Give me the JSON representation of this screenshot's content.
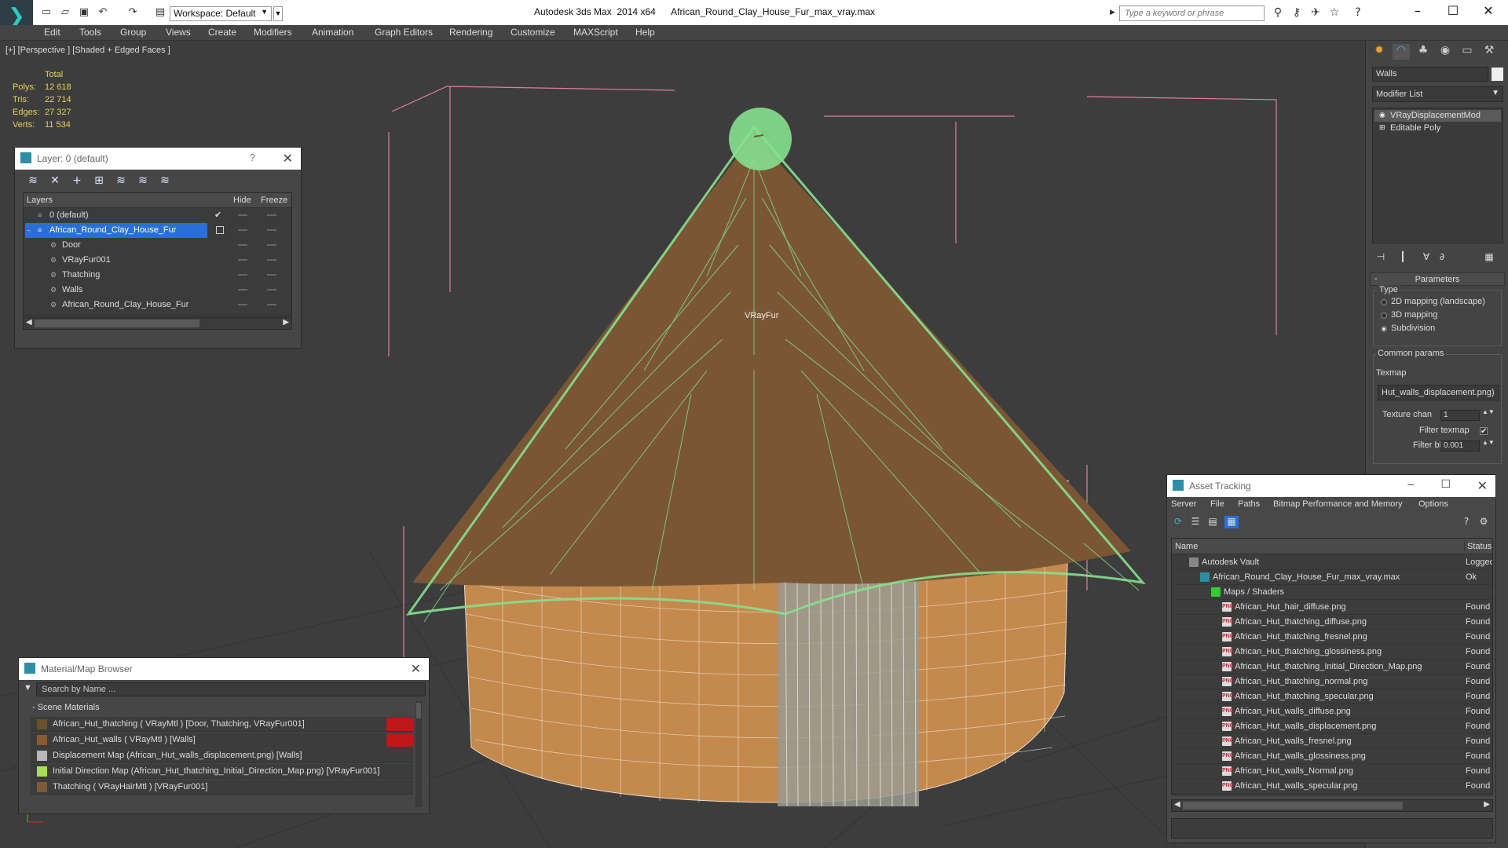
{
  "titlebar": {
    "workspace": "Workspace: Default",
    "app_title": "Autodesk 3ds Max  2014 x64      African_Round_Clay_House_Fur_max_vray.max",
    "search_placeholder": "Type a keyword or phrase"
  },
  "menu": [
    "Edit",
    "Tools",
    "Group",
    "Views",
    "Create",
    "Modifiers",
    "Animation",
    "Graph Editors",
    "Rendering",
    "Customize",
    "MAXScript",
    "Help"
  ],
  "viewport": {
    "label": "[+] [Perspective ] [Shaded + Edged Faces ]",
    "stats": {
      "total_label": "Total",
      "rows": [
        {
          "label": "Polys:",
          "value": "12 618"
        },
        {
          "label": "Tris:",
          "value": "22 714"
        },
        {
          "label": "Edges:",
          "value": "27 327"
        },
        {
          "label": "Verts:",
          "value": "11 534"
        }
      ]
    },
    "object_label": "VRayFur"
  },
  "layer_window": {
    "title": "Layer: 0 (default)",
    "help": "?",
    "columns": {
      "layers": "Layers",
      "hide": "Hide",
      "freeze": "Freeze"
    },
    "rows": [
      {
        "name": "0 (default)",
        "level": 0,
        "active": true
      },
      {
        "name": "African_Round_Clay_House_Fur",
        "level": 0,
        "selected": true
      },
      {
        "name": "Door",
        "level": 1
      },
      {
        "name": "VRayFur001",
        "level": 1
      },
      {
        "name": "Thatching",
        "level": 1
      },
      {
        "name": "Walls",
        "level": 1
      },
      {
        "name": "African_Round_Clay_House_Fur",
        "level": 1
      }
    ]
  },
  "material_browser": {
    "title": "Material/Map Browser",
    "search_placeholder": "Search by Name ...",
    "group": "- Scene Materials",
    "items": [
      {
        "text": "African_Hut_thatching  ( VRayMtl ) [Door, Thatching, VRayFur001]",
        "swatch": "#6a5230",
        "flag": true
      },
      {
        "text": "African_Hut_walls  ( VRayMtl ) [Walls]",
        "swatch": "#8a5a30",
        "flag": true
      },
      {
        "text": "Displacement Map (African_Hut_walls_displacement.png) [Walls]",
        "swatch": "#b8b8b8",
        "flag": false
      },
      {
        "text": "Initial Direction Map (African_Hut_thatching_Initial_Direction_Map.png) [VRayFur001]",
        "swatch": "#a8e04a",
        "flag": false
      },
      {
        "text": "Thatching  ( VRayHairMtl ) [VRayFur001]",
        "swatch": "#7a5a38",
        "flag": false
      }
    ]
  },
  "command_panel": {
    "object_name": "Walls",
    "modifier_list": "Modifier List",
    "stack": [
      "VRayDisplacementMod",
      "Editable Poly"
    ],
    "parameters_title": "Parameters",
    "type_label": "Type",
    "type_options": [
      "2D mapping (landscape)",
      "3D mapping",
      "Subdivision"
    ],
    "selected_type": 2,
    "common_params": "Common params",
    "texmap_label": "Texmap",
    "texmap_value": "Hut_walls_displacement.png)",
    "texture_chan_label": "Texture chan",
    "texture_chan_value": "1",
    "filter_texmap_label": "Filter texmap",
    "filter_blur_label": "Filter blur",
    "filter_blur_value": "0.001"
  },
  "asset_tracking": {
    "title": "Asset Tracking",
    "menu": [
      "Server",
      "File",
      "Paths",
      "Bitmap Performance and Memory",
      "Options"
    ],
    "columns": {
      "name": "Name",
      "status": "Status"
    },
    "rows": [
      {
        "name": "Autodesk Vault",
        "status": "Logged",
        "level": 0,
        "icon": "vault"
      },
      {
        "name": "African_Round_Clay_House_Fur_max_vray.max",
        "status": "Ok",
        "level": 1,
        "icon": "max"
      },
      {
        "name": "Maps / Shaders",
        "status": "",
        "level": 2,
        "icon": "maps"
      },
      {
        "name": "African_Hut_hair_diffuse.png",
        "status": "Found",
        "level": 3,
        "icon": "png"
      },
      {
        "name": "African_Hut_thatching_diffuse.png",
        "status": "Found",
        "level": 3,
        "icon": "png"
      },
      {
        "name": "African_Hut_thatching_fresnel.png",
        "status": "Found",
        "level": 3,
        "icon": "png"
      },
      {
        "name": "African_Hut_thatching_glossiness.png",
        "status": "Found",
        "level": 3,
        "icon": "png"
      },
      {
        "name": "African_Hut_thatching_Initial_Direction_Map.png",
        "status": "Found",
        "level": 3,
        "icon": "png"
      },
      {
        "name": "African_Hut_thatching_normal.png",
        "status": "Found",
        "level": 3,
        "icon": "png"
      },
      {
        "name": "African_Hut_thatching_specular.png",
        "status": "Found",
        "level": 3,
        "icon": "png"
      },
      {
        "name": "African_Hut_walls_diffuse.png",
        "status": "Found",
        "level": 3,
        "icon": "png"
      },
      {
        "name": "African_Hut_walls_displacement.png",
        "status": "Found",
        "level": 3,
        "icon": "png"
      },
      {
        "name": "African_Hut_walls_fresnel.png",
        "status": "Found",
        "level": 3,
        "icon": "png"
      },
      {
        "name": "African_Hut_walls_glossiness.png",
        "status": "Found",
        "level": 3,
        "icon": "png"
      },
      {
        "name": "African_Hut_walls_Normal.png",
        "status": "Found",
        "level": 3,
        "icon": "png"
      },
      {
        "name": "African_Hut_walls_specular.png",
        "status": "Found",
        "level": 3,
        "icon": "png"
      }
    ]
  },
  "colors": {
    "selection": "#2a6fd6",
    "stats_text": "#e6d25a",
    "fur": "#86e08f",
    "roof": "#7a5634",
    "wall": "#c88a50",
    "bbox": "#e07da0",
    "flag_red": "#c01818"
  }
}
